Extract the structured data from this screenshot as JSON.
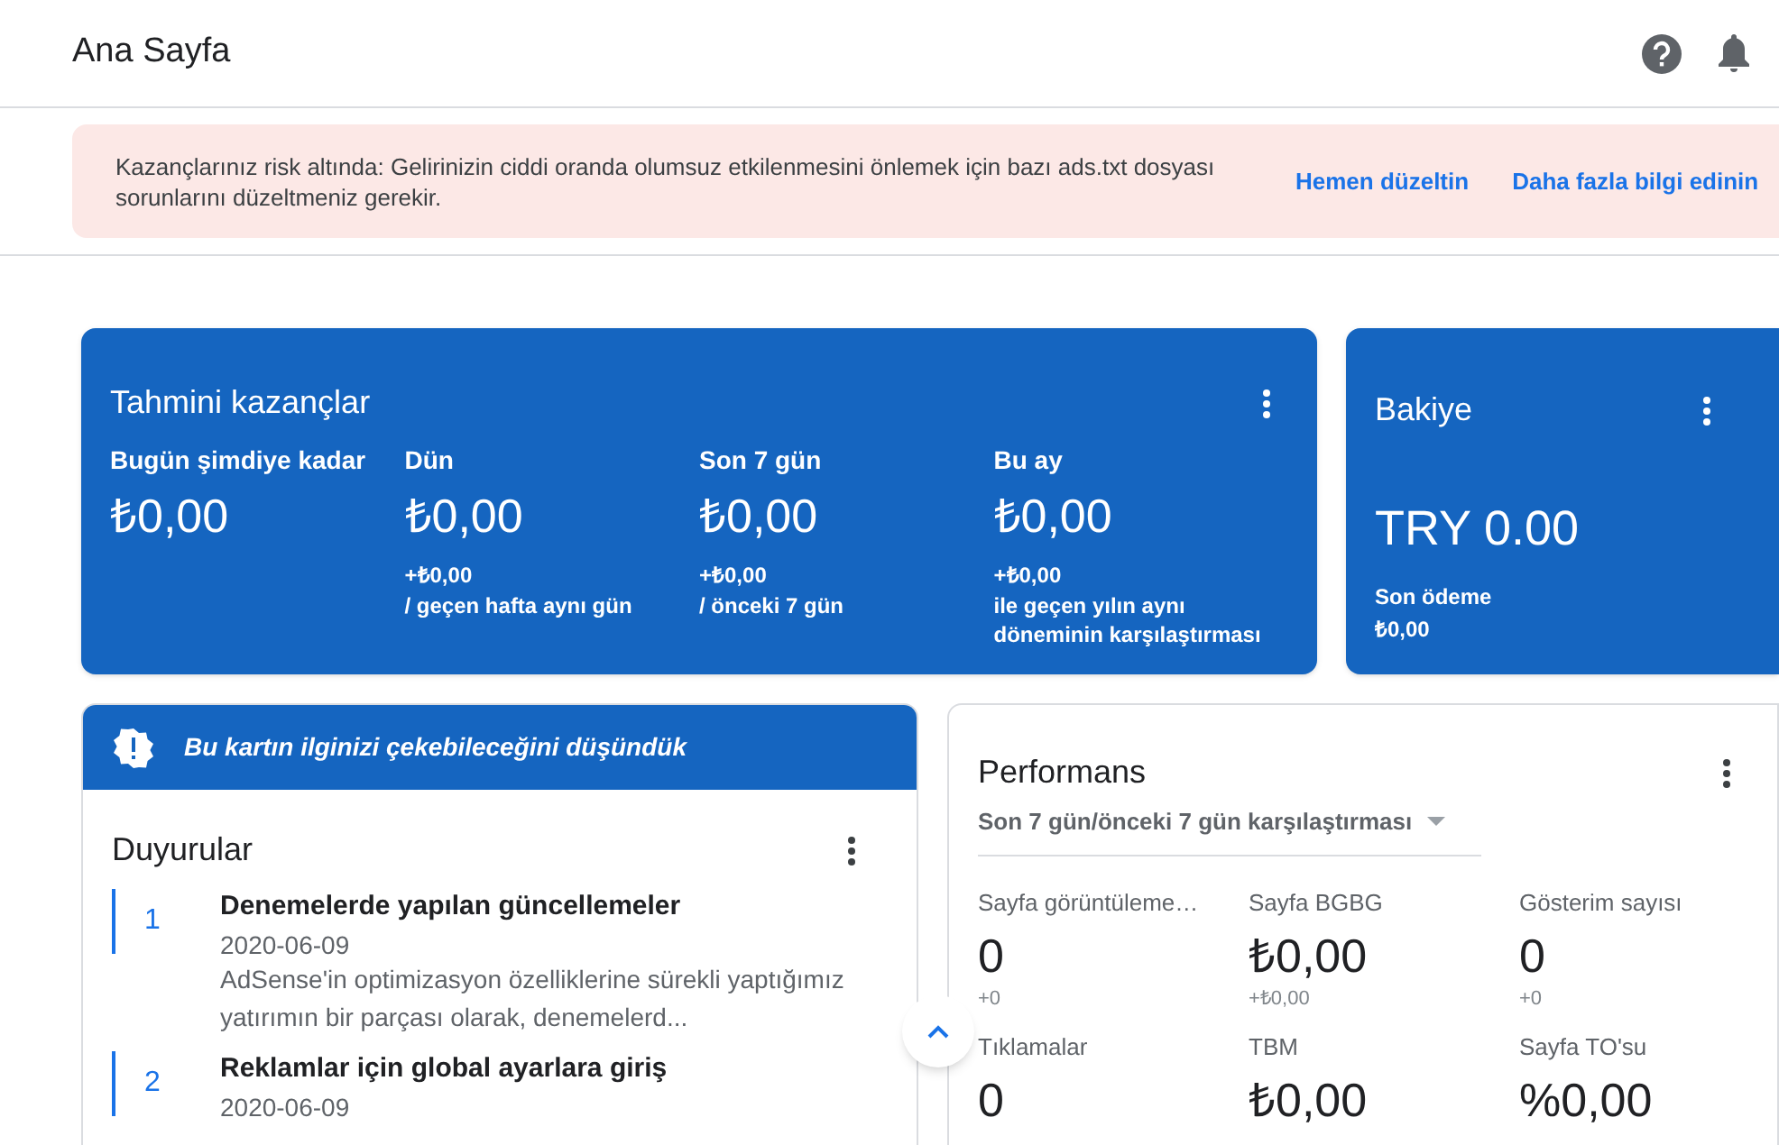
{
  "header": {
    "title": "Ana Sayfa"
  },
  "alert": {
    "message": "Kazançlarınız risk altında: Gelirinizin ciddi oranda olumsuz etkilenmesini önlemek için bazı ads.txt dosyası sorunlarını düzeltmeniz gerekir.",
    "actions": [
      "Hemen düzeltin",
      "Daha fazla bilgi edinin"
    ]
  },
  "earnings": {
    "title": "Tahmini kazançlar",
    "periods": [
      {
        "label": "Bugün şimdiye kadar",
        "value": "₺0,00"
      },
      {
        "label": "Dün",
        "value": "₺0,00",
        "change": "+₺0,00",
        "comparison": "/ geçen hafta aynı gün"
      },
      {
        "label": "Son 7 gün",
        "value": "₺0,00",
        "change": "+₺0,00",
        "comparison": "/ önceki 7 gün"
      },
      {
        "label": "Bu ay",
        "value": "₺0,00",
        "change": "+₺0,00",
        "comparison": "ile geçen yılın aynı döneminin karşılaştırması"
      }
    ]
  },
  "balance": {
    "title": "Bakiye",
    "value": "TRY 0.00",
    "last_payment_label": "Son ödeme",
    "last_payment_value": "₺0,00"
  },
  "suggestion": {
    "text": "Bu kartın ilginizi çekebileceğini düşündük"
  },
  "announcements": {
    "title": "Duyurular",
    "items": [
      {
        "number": "1",
        "title": "Denemelerde yapılan güncellemeler",
        "date": "2020-06-09",
        "summary": "AdSense'in optimizasyon özelliklerine sürekli yaptığımız yatırımın bir parçası olarak, denemelerd..."
      },
      {
        "number": "2",
        "title": "Reklamlar için global ayarlara giriş",
        "date": "2020-06-09"
      }
    ]
  },
  "performance": {
    "title": "Performans",
    "period": "Son 7 gün/önceki 7 gün karşılaştırması",
    "metrics": [
      {
        "label": "Sayfa görüntüleme…",
        "value": "0",
        "change": "+0"
      },
      {
        "label": "Sayfa BGBG",
        "value": "₺0,00",
        "change": "+₺0,00"
      },
      {
        "label": "Gösterim sayısı",
        "value": "0",
        "change": "+0"
      },
      {
        "label": "Tıklamalar",
        "value": "0"
      },
      {
        "label": "TBM",
        "value": "₺0,00"
      },
      {
        "label": "Sayfa TO'su",
        "value": "%0,00"
      }
    ]
  }
}
